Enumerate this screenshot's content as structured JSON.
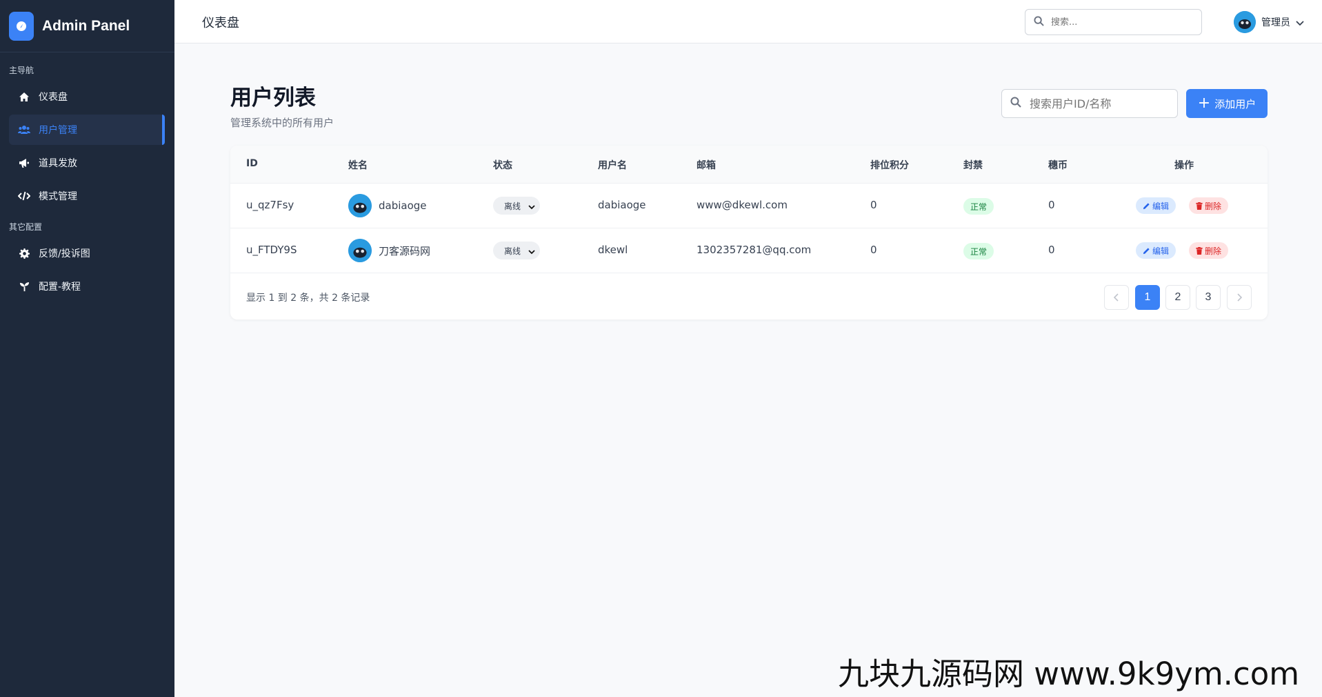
{
  "sidebar": {
    "brand": "Admin Panel",
    "sections": [
      {
        "label": "主导航"
      },
      {
        "label": "其它配置"
      }
    ],
    "items": [
      {
        "label": "仪表盘",
        "icon": "home-icon"
      },
      {
        "label": "用户管理",
        "icon": "users-icon",
        "active": true
      },
      {
        "label": "道具发放",
        "icon": "megaphone-icon"
      },
      {
        "label": "模式管理",
        "icon": "code-icon"
      },
      {
        "label": "反馈/投诉图",
        "icon": "gear-icon"
      },
      {
        "label": "配置-教程",
        "icon": "seedling-icon"
      }
    ]
  },
  "topbar": {
    "title": "仪表盘",
    "search_placeholder": "搜索...",
    "user_name": "管理员"
  },
  "page": {
    "title": "用户列表",
    "subtitle": "管理系统中的所有用户",
    "search_placeholder": "搜索用户ID/名称",
    "add_button": "添加用户"
  },
  "table": {
    "headers": [
      "ID",
      "姓名",
      "状态",
      "用户名",
      "邮箱",
      "排位积分",
      "封禁",
      "穗币",
      "操作"
    ],
    "rows": [
      {
        "id": "u_qz7Fsy",
        "name": "dabiaoge",
        "status": "离线",
        "username": "dabiaoge",
        "email": "www@dkewl.com",
        "rank": "0",
        "ban": "正常",
        "coins": "0",
        "edit": "编辑",
        "delete": "删除"
      },
      {
        "id": "u_FTDY9S",
        "name": "刀客源码网",
        "status": "离线",
        "username": "dkewl",
        "email": "1302357281@qq.com",
        "rank": "0",
        "ban": "正常",
        "coins": "0",
        "edit": "编辑",
        "delete": "删除"
      }
    ],
    "footer_info": "显示 1 到 2 条，共 2 条记录",
    "pages": [
      "1",
      "2",
      "3"
    ],
    "current_page": "1"
  },
  "watermark": "九块九源码网 www.9k9ym.com",
  "colors": {
    "sidebar_bg": "#1e293b",
    "accent": "#3b82f6",
    "success": "#15803d",
    "danger": "#dc2626"
  }
}
